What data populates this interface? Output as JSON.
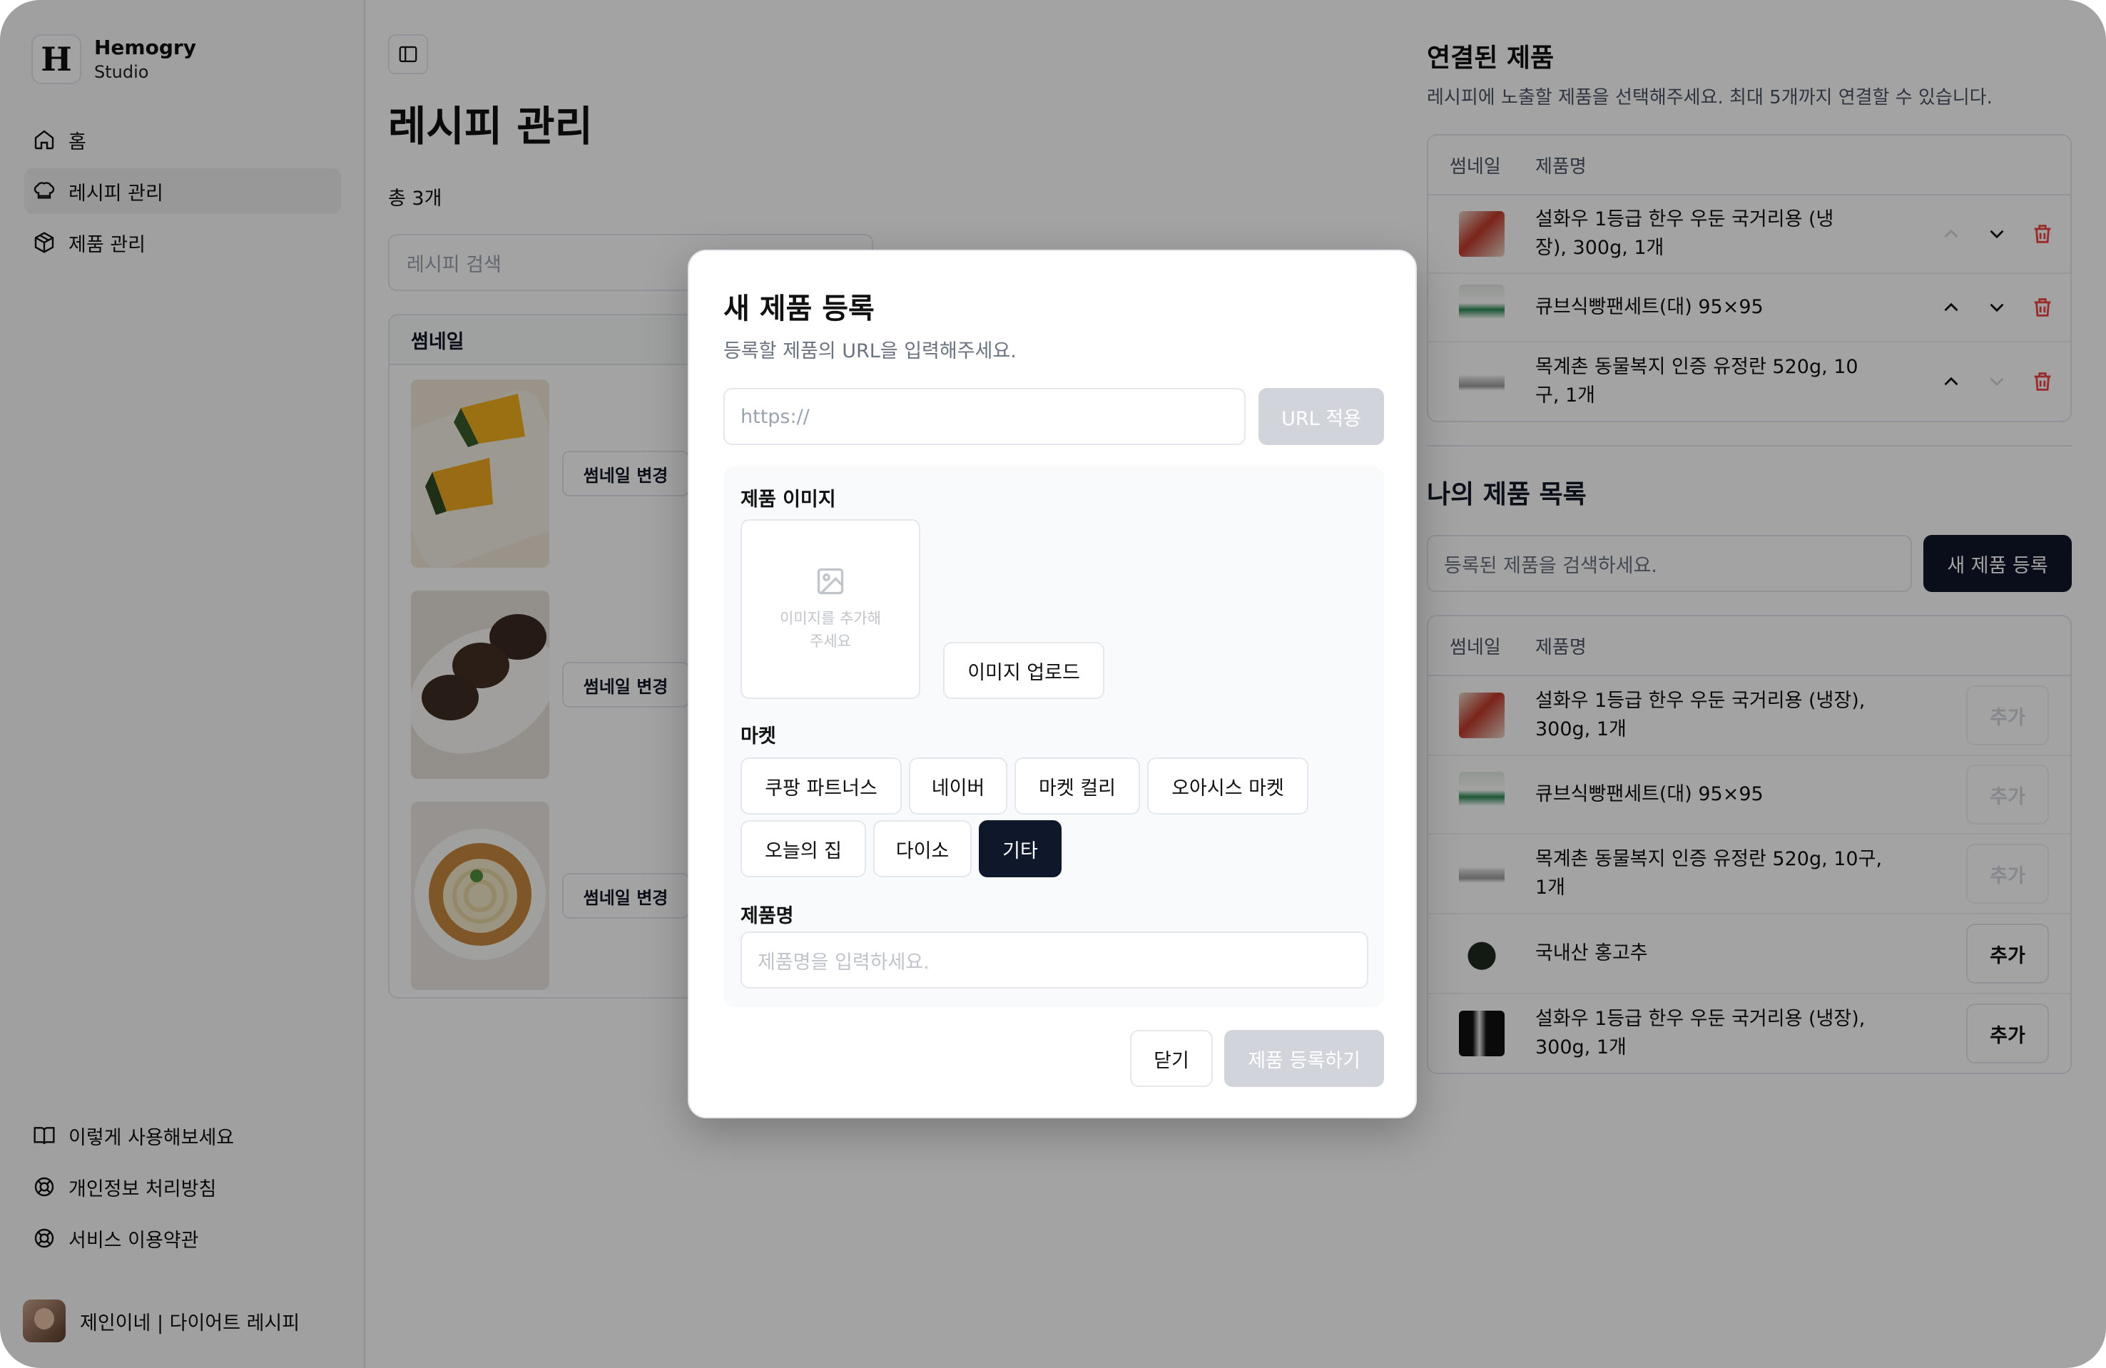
{
  "brand": {
    "name": "Hemogry",
    "sub": "Studio",
    "logo": "H"
  },
  "sidebar": {
    "items": [
      {
        "label": "홈",
        "icon": "home-icon"
      },
      {
        "label": "레시피 관리",
        "icon": "chef-hat-icon"
      },
      {
        "label": "제품 관리",
        "icon": "package-icon"
      }
    ],
    "bottom": [
      {
        "label": "이렇게 사용해보세요",
        "icon": "book-open-icon"
      },
      {
        "label": "개인정보 처리방침",
        "icon": "life-buoy-icon"
      },
      {
        "label": "서비스 이용약관",
        "icon": "life-buoy-icon"
      }
    ],
    "profile": "제인이네 | 다이어트 레시피"
  },
  "main": {
    "title": "레시피 관리",
    "total": "총 3개",
    "search_placeholder": "레시피 검색",
    "table_header": "썸네일",
    "thumb_button": "썸네일 변경"
  },
  "linked": {
    "title": "연결된 제품",
    "desc": "레시피에 노출할 제품을 선택해주세요. 최대 5개까지 연결할 수 있습니다.",
    "col_thumb": "썸네일",
    "col_name": "제품명",
    "rows": [
      {
        "name": "설화우 1등급 한우 우둔 국거리용 (냉\n장), 300g, 1개"
      },
      {
        "name": "큐브식빵팬세트(대) 95×95"
      },
      {
        "name": "목계촌 동물복지 인증 유정란 520g, 10\n구, 1개"
      }
    ]
  },
  "mine": {
    "title": "나의 제품 목록",
    "search_placeholder": "등록된 제품을 검색하세요.",
    "new_button": "새 제품 등록",
    "col_thumb": "썸네일",
    "col_name": "제품명",
    "add_label": "추가",
    "rows": [
      {
        "name": "설화우 1등급 한우 우둔 국거리용 (냉장),\n300g, 1개",
        "enabled": false
      },
      {
        "name": "큐브식빵팬세트(대) 95×95",
        "enabled": false
      },
      {
        "name": "목계촌 동물복지 인증 유정란 520g, 10구,\n1개",
        "enabled": false
      },
      {
        "name": "국내산 홍고추",
        "enabled": true
      },
      {
        "name": "설화우 1등급 한우 우둔 국거리용 (냉장),\n300g, 1개",
        "enabled": true
      }
    ]
  },
  "modal": {
    "title": "새 제품 등록",
    "desc": "등록할 제품의 URL을 입력해주세요.",
    "url_placeholder": "https://",
    "url_button": "URL 적용",
    "image_label": "제품 이미지",
    "image_hint": "이미지를 추가해주세요",
    "upload_button": "이미지 업로드",
    "market_label": "마켓",
    "markets": [
      "쿠팡 파트너스",
      "네이버",
      "마켓 컬리",
      "오아시스 마켓",
      "오늘의 집",
      "다이소",
      "기타"
    ],
    "selected_market": "기타",
    "name_label": "제품명",
    "name_placeholder": "제품명을 입력하세요.",
    "close_button": "닫기",
    "submit_button": "제품 등록하기"
  }
}
